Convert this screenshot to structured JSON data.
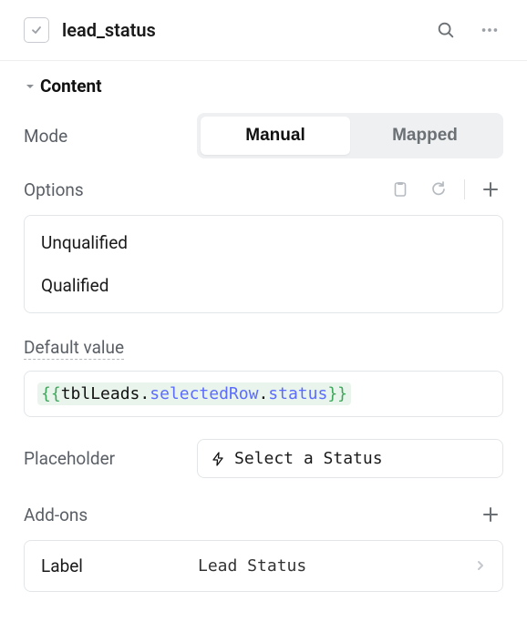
{
  "header": {
    "title": "lead_status"
  },
  "section": {
    "title": "Content"
  },
  "mode": {
    "label": "Mode",
    "manual": "Manual",
    "mapped": "Mapped",
    "active": "manual"
  },
  "options": {
    "label": "Options",
    "items": [
      "Unqualified",
      "Qualified"
    ]
  },
  "defaultValue": {
    "label": "Default value",
    "expression": {
      "open": "{{",
      "obj": "tblLeads",
      "dot1": ".",
      "prop1": "selectedRow",
      "dot2": ".",
      "prop2": "status",
      "close": "}}"
    }
  },
  "placeholder": {
    "label": "Placeholder",
    "value": "Select a Status"
  },
  "addons": {
    "label": "Add-ons",
    "items": [
      {
        "label": "Label",
        "value": "Lead Status"
      }
    ]
  }
}
